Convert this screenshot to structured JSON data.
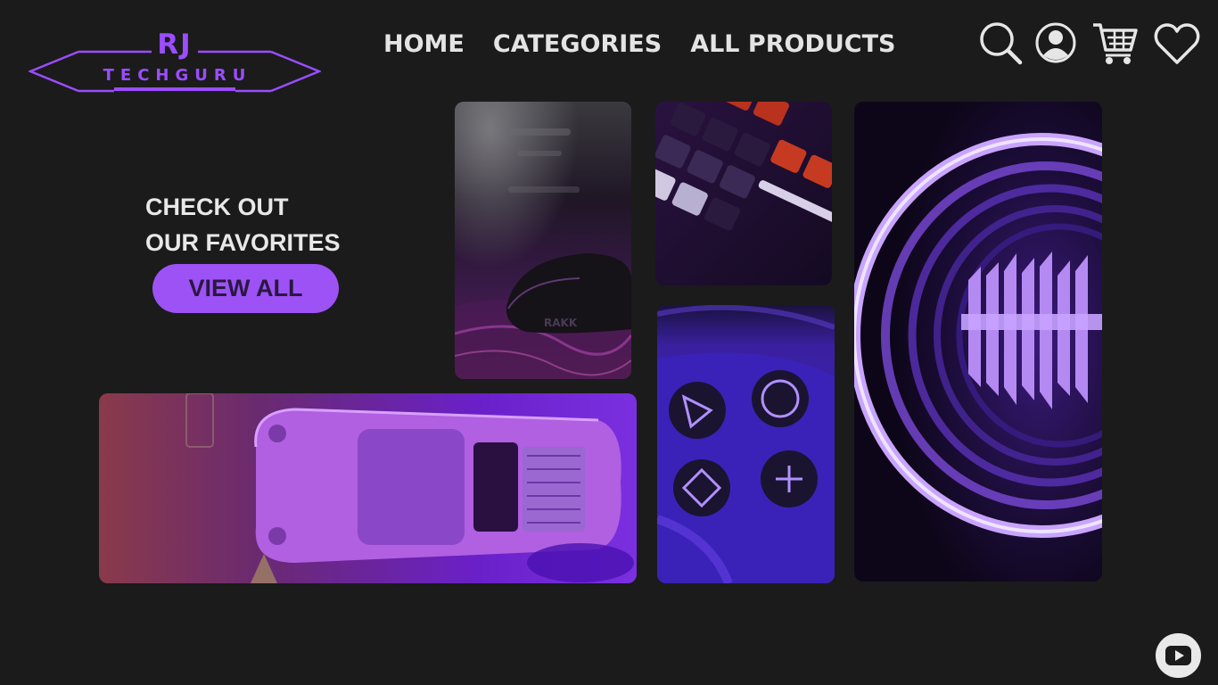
{
  "logo": {
    "top_text": "RJ",
    "bottom_text": "TECHGURU",
    "color": "#9b4dff"
  },
  "nav": {
    "items": [
      "HOME",
      "CATEGORIES",
      "ALL PRODUCTS"
    ]
  },
  "header_icons": [
    "search-icon",
    "user-icon",
    "cart-icon",
    "heart-icon"
  ],
  "hero": {
    "line1": "CHECK OUT",
    "line2": "OUR FAVORITES",
    "button_label": "VIEW ALL"
  },
  "gallery": {
    "tiles": [
      "mouse-photo",
      "keyboard-photo",
      "infinity-mirror-photo",
      "toy-car-photo",
      "gamepad-photo"
    ]
  },
  "social": {
    "icon": "youtube-icon"
  },
  "colors": {
    "background": "#1b1b1b",
    "accent": "#9d52f5",
    "text": "#e4e4e4"
  }
}
